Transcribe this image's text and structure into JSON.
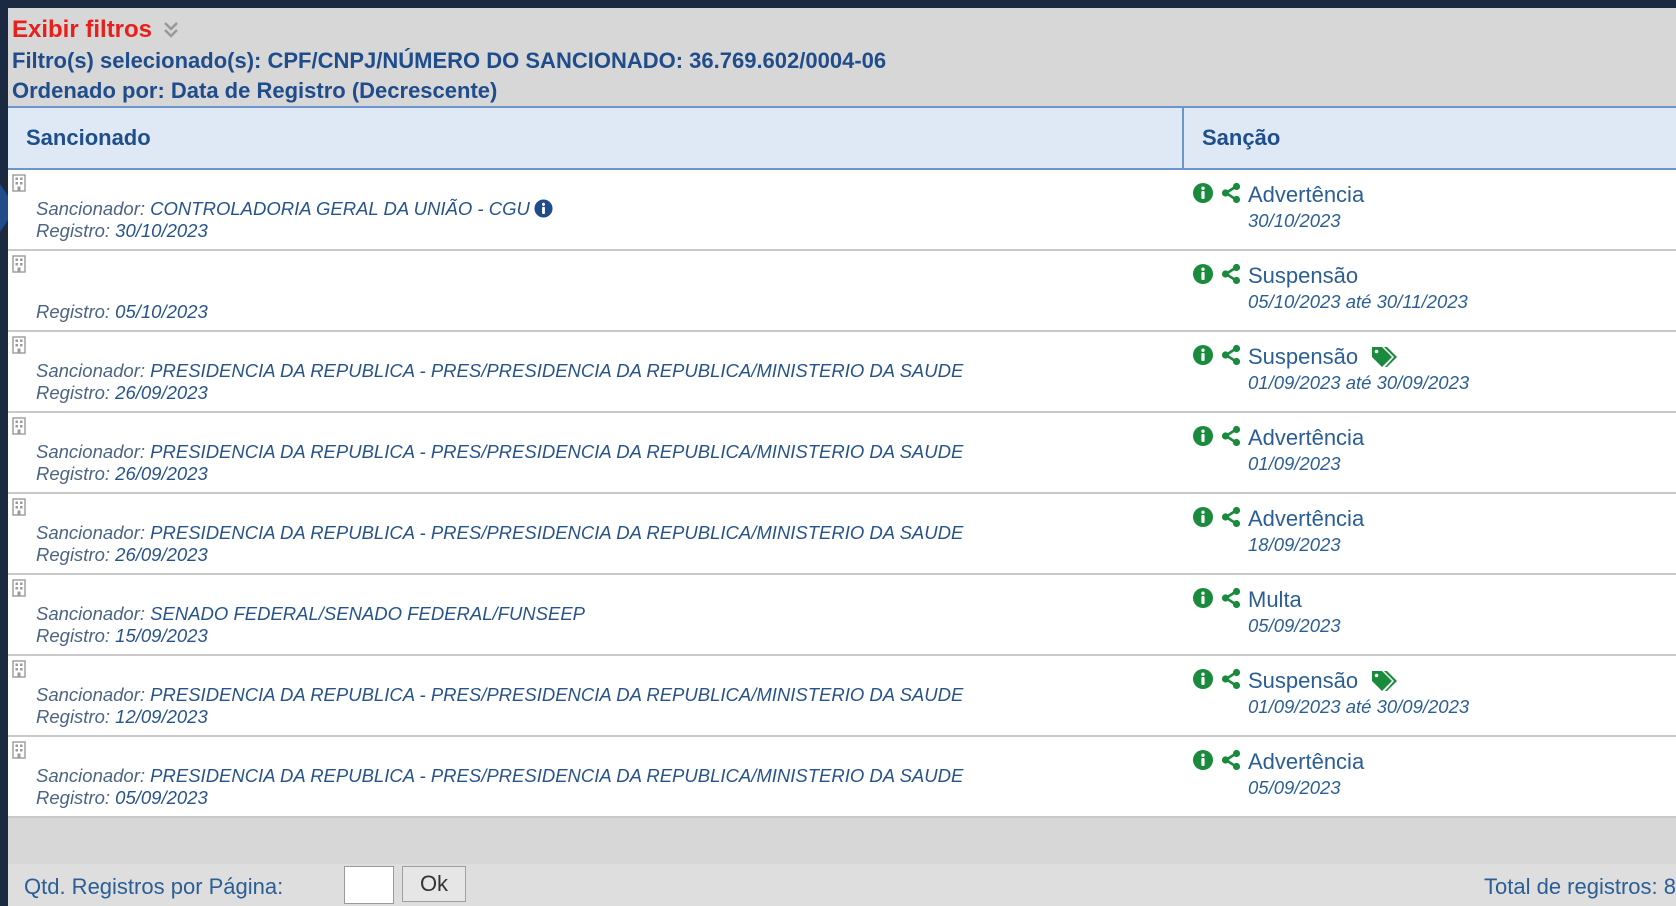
{
  "filters": {
    "toggle_label": "Exibir filtros",
    "selected": "Filtro(s) selecionado(s): CPF/CNPJ/NÚMERO DO SANCIONADO: 36.769.602/0004-06",
    "order": "Ordenado por: Data de Registro (Decrescente)"
  },
  "table": {
    "headers": [
      "Sancionado",
      "Sanção"
    ],
    "rows": [
      {
        "sancionador_label": "Sancionador:",
        "sancionador": "CONTROLADORIA GERAL DA UNIÃO - CGU",
        "registro_label": "Registro:",
        "registro": "30/10/2023",
        "sancao": "Advertência",
        "periodo": "30/10/2023",
        "tag": false
      },
      {
        "sancionador_label": "",
        "sancionador": "",
        "registro_label": "Registro:",
        "registro": "05/10/2023",
        "sancao": "Suspensão",
        "periodo": "05/10/2023 até 30/11/2023",
        "tag": false
      },
      {
        "sancionador_label": "Sancionador:",
        "sancionador": "PRESIDENCIA DA REPUBLICA - PRES/PRESIDENCIA DA REPUBLICA/MINISTERIO DA SAUDE",
        "registro_label": "Registro:",
        "registro": "26/09/2023",
        "sancao": "Suspensão",
        "periodo": "01/09/2023 até 30/09/2023",
        "tag": true
      },
      {
        "sancionador_label": "Sancionador:",
        "sancionador": "PRESIDENCIA DA REPUBLICA - PRES/PRESIDENCIA DA REPUBLICA/MINISTERIO DA SAUDE",
        "registro_label": "Registro:",
        "registro": "26/09/2023",
        "sancao": "Advertência",
        "periodo": "01/09/2023",
        "tag": false
      },
      {
        "sancionador_label": "Sancionador:",
        "sancionador": "PRESIDENCIA DA REPUBLICA - PRES/PRESIDENCIA DA REPUBLICA/MINISTERIO DA SAUDE",
        "registro_label": "Registro:",
        "registro": "26/09/2023",
        "sancao": "Advertência",
        "periodo": "18/09/2023",
        "tag": false
      },
      {
        "sancionador_label": "Sancionador:",
        "sancionador": "SENADO FEDERAL/SENADO FEDERAL/FUNSEEP",
        "registro_label": "Registro:",
        "registro": "15/09/2023",
        "sancao": "Multa",
        "periodo": "05/09/2023",
        "tag": false
      },
      {
        "sancionador_label": "Sancionador:",
        "sancionador": "PRESIDENCIA DA REPUBLICA - PRES/PRESIDENCIA DA REPUBLICA/MINISTERIO DA SAUDE",
        "registro_label": "Registro:",
        "registro": "12/09/2023",
        "sancao": "Suspensão",
        "periodo": "01/09/2023 até 30/09/2023",
        "tag": true
      },
      {
        "sancionador_label": "Sancionador:",
        "sancionador": "PRESIDENCIA DA REPUBLICA - PRES/PRESIDENCIA DA REPUBLICA/MINISTERIO DA SAUDE",
        "registro_label": "Registro:",
        "registro": "05/09/2023",
        "sancao": "Advertência",
        "periodo": "05/09/2023",
        "tag": false
      }
    ]
  },
  "pagination": {
    "per_page_label": "Qtd. Registros por Página:",
    "per_page_value": "",
    "ok_label": "Ok",
    "total_label": "Total de registros: 8"
  },
  "colors": {
    "accent_red": "#e8201c",
    "link_blue": "#2b5e94",
    "icon_green": "#1a8a3c",
    "header_bg": "#dfe8f5"
  }
}
